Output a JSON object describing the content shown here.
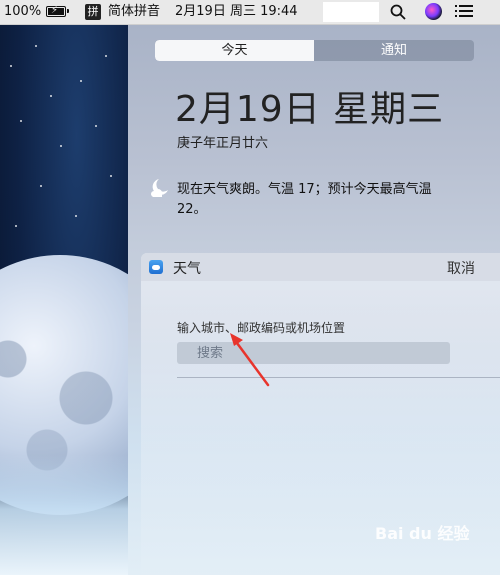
{
  "menubar": {
    "battery_percent": "100%",
    "ime_icon_char": "拼",
    "ime_label": "简体拼音",
    "datetime": "2月19日 周三  19:44",
    "icons": [
      "battery-charging-icon",
      "search-icon",
      "siri-icon",
      "notification-center-icon"
    ]
  },
  "notification_center": {
    "tabs": [
      {
        "label": "今天",
        "selected": true
      },
      {
        "label": "通知",
        "selected": false
      }
    ],
    "date": "2月19日 星期三",
    "lunar_date": "庚子年正月廿六",
    "weather_summary": "现在天气爽朗。气温 17；预计今天最高气温 22。",
    "weather_icon": "moon-cloud-icon"
  },
  "weather_widget": {
    "title": "天气",
    "cancel_label": "取消",
    "prompt": "输入城市、邮政编码或机场位置",
    "search_placeholder": "搜索",
    "search_value": ""
  },
  "watermark": "Bai du 经验",
  "colors": {
    "annotation_arrow": "#e8342c",
    "segment_selected_bg": "#f6f7f9"
  }
}
